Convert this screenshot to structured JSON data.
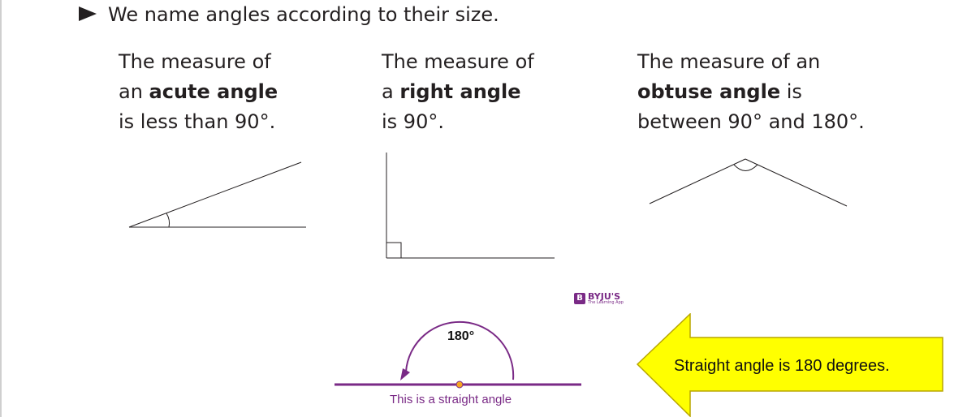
{
  "header": {
    "text": "We name angles according to their size."
  },
  "columns": {
    "acute": {
      "line1": "The measure of",
      "line2_prefix": "an ",
      "line2_bold": "acute angle",
      "line3": "is less than 90°."
    },
    "right": {
      "line1": "The measure of",
      "line2_prefix": "a ",
      "line2_bold": "right angle",
      "line3": "is 90°."
    },
    "obtuse": {
      "line1": "The measure of an",
      "line2_bold": "obtuse angle",
      "line2_suffix": " is",
      "line3": "between 90° and 180°."
    }
  },
  "logo": {
    "mark": "B",
    "name": "BYJU'S",
    "tagline": "The Learning App"
  },
  "straight_angle": {
    "angle_label": "180°",
    "caption": "This is a straight angle"
  },
  "callout": {
    "text": "Straight angle is 180 degrees."
  },
  "colors": {
    "text": "#231f20",
    "purple": "#7a2a86",
    "arrow_fill": "#ffff00",
    "arrow_stroke": "#b8a600",
    "vertex_dot": "#f5a623"
  }
}
